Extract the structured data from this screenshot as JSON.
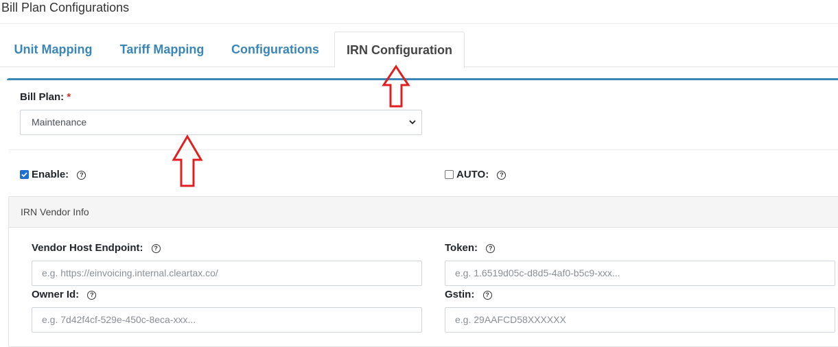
{
  "page": {
    "title": "Bill Plan Configurations"
  },
  "tabs": [
    {
      "label": "Unit Mapping",
      "active": false
    },
    {
      "label": "Tariff Mapping",
      "active": false
    },
    {
      "label": "Configurations",
      "active": false
    },
    {
      "label": "IRN Configuration",
      "active": true
    }
  ],
  "bill_plan": {
    "label": "Bill Plan:",
    "required_marker": "*",
    "selected": "Maintenance"
  },
  "toggles": {
    "enable": {
      "label": "Enable:",
      "checked": true
    },
    "auto": {
      "label": "AUTO:",
      "checked": false
    }
  },
  "help_glyph": "?",
  "vendor_panel": {
    "title": "IRN Vendor Info",
    "fields": {
      "host": {
        "label": "Vendor Host Endpoint:",
        "placeholder": "e.g. https://einvoicing.internal.cleartax.co/"
      },
      "token": {
        "label": "Token:",
        "placeholder": "e.g. 1.6519d05c-d8d5-4af0-b5c9-xxx..."
      },
      "owner": {
        "label": "Owner Id:",
        "placeholder": "e.g. 7d42f4cf-529e-450c-8eca-xxx..."
      },
      "gstin": {
        "label": "Gstin:",
        "placeholder": "e.g. 29AAFCD58XXXXXX"
      }
    }
  },
  "colors": {
    "link": "#3a86b8",
    "accent_rule": "#3a86b8",
    "annotation_arrow": "#e02020",
    "checkbox": "#1f6fd1"
  },
  "icons": {
    "dropdown": "chevron-down-icon",
    "help": "question-circle-icon",
    "annotation": "arrow-up-annotation-icon"
  }
}
